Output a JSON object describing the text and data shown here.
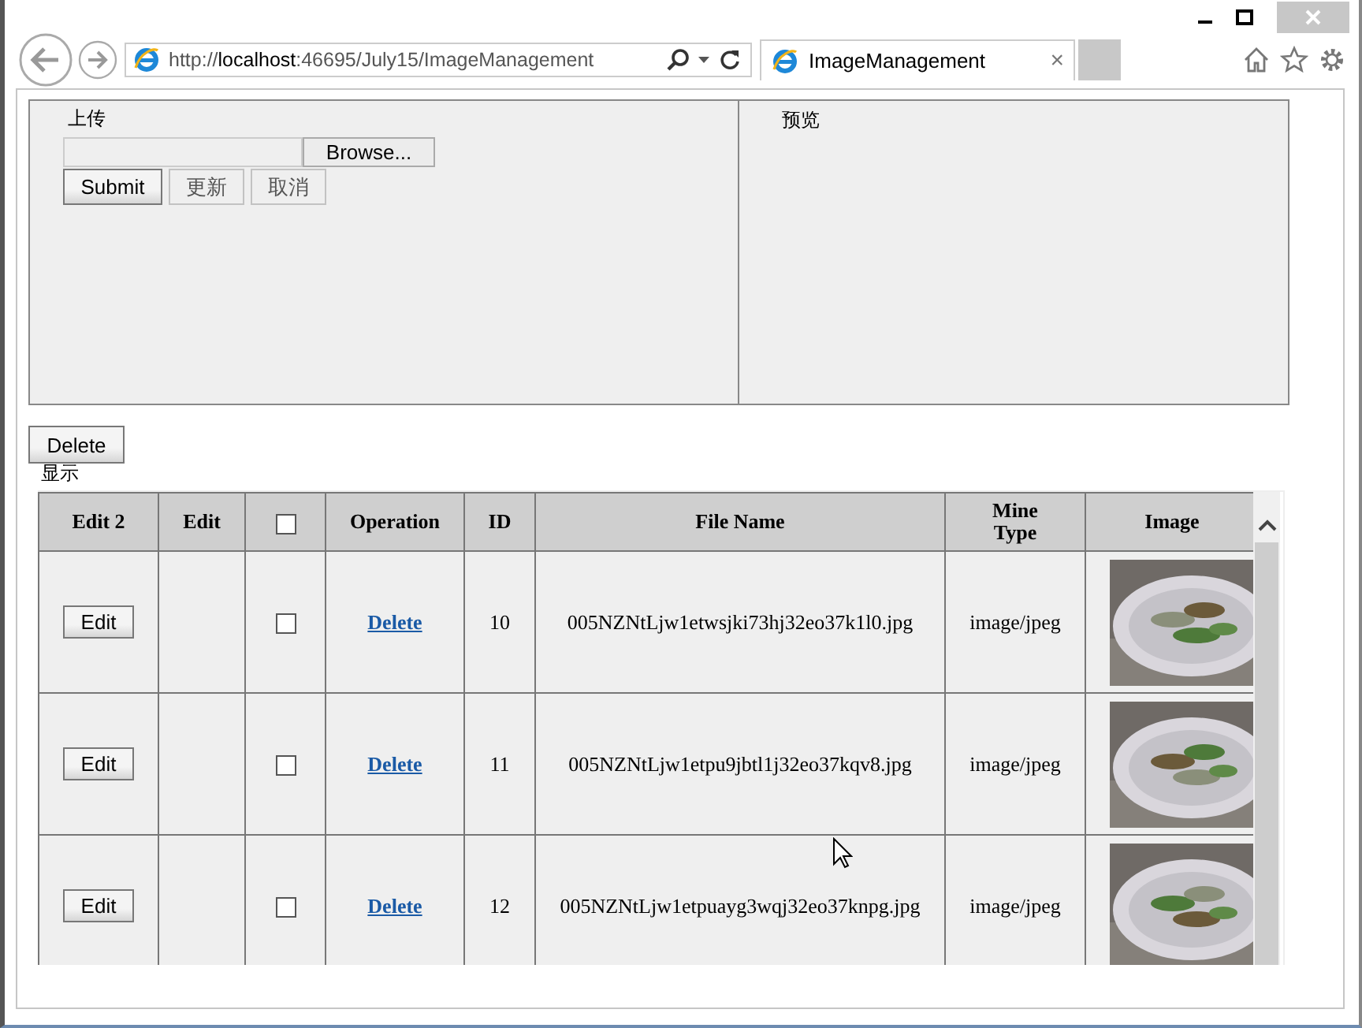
{
  "browser": {
    "address": "http://**localhost**:46695/July15/ImageManagement",
    "tab": {
      "title": "ImageManagement",
      "close": "×"
    }
  },
  "upload": {
    "label": "上传",
    "browse": "Browse...",
    "submit": "Submit",
    "refresh": "更新",
    "cancel": "取消"
  },
  "preview": {
    "label": "预览"
  },
  "delete_button": "Delete",
  "section_label": "显示",
  "table": {
    "columns": [
      {
        "label": "Edit 2",
        "kind": "text"
      },
      {
        "label": "Edit",
        "kind": "text"
      },
      {
        "kind": "checkbox",
        "checked": false
      },
      {
        "label": "Operation",
        "kind": "text"
      },
      {
        "label": "ID",
        "kind": "text"
      },
      {
        "label": "File Name",
        "kind": "text"
      },
      {
        "label": "Mine Type",
        "kind": "text"
      },
      {
        "label": "Image",
        "kind": "text"
      }
    ],
    "rows": [
      {
        "edit": "Edit",
        "checked": false,
        "operation": "Delete",
        "id": "10",
        "file_name": "005NZNtLjw1etwsjki73hj32eo37k1l0.jpg",
        "mime_type": "image/jpeg"
      },
      {
        "edit": "Edit",
        "checked": false,
        "operation": "Delete",
        "id": "11",
        "file_name": "005NZNtLjw1etpu9jbtl1j32eo37kqv8.jpg",
        "mime_type": "image/jpeg"
      },
      {
        "edit": "Edit",
        "checked": false,
        "operation": "Delete",
        "id": "12",
        "file_name": "005NZNtLjw1etpuayg3wqj32eo37knpg.jpg",
        "mime_type": "image/jpeg"
      }
    ]
  }
}
